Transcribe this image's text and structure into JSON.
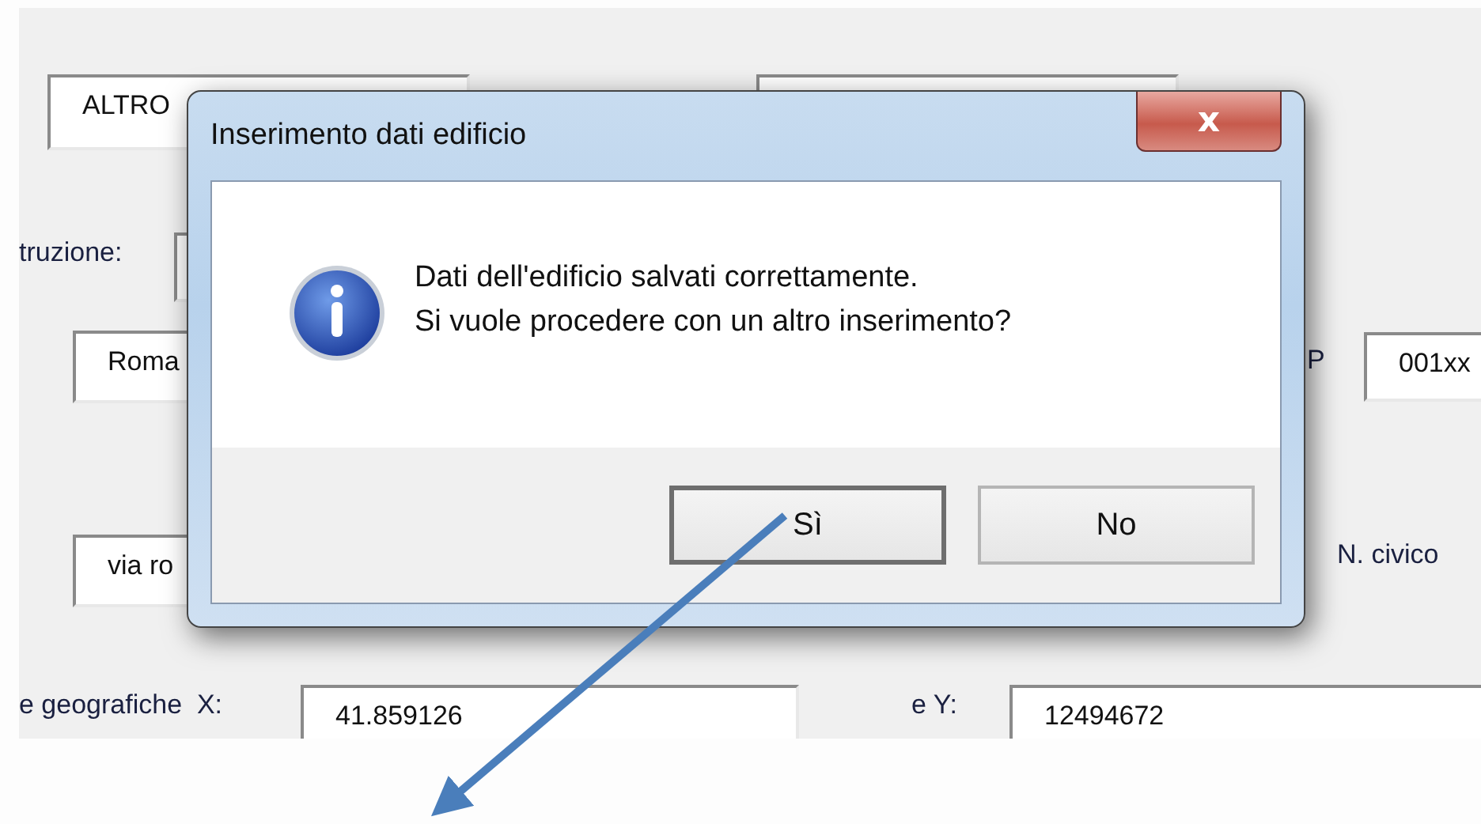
{
  "form": {
    "items": [
      {
        "kind": "field",
        "value": "ALTRO"
      },
      {
        "kind": "field",
        "value": ""
      },
      {
        "kind": "label",
        "text": "truzione:"
      },
      {
        "kind": "field",
        "value": ""
      },
      {
        "kind": "field",
        "value": "Roma"
      },
      {
        "kind": "label",
        "text": "P"
      },
      {
        "kind": "field",
        "value": "001xx"
      },
      {
        "kind": "field",
        "value": "via ro"
      },
      {
        "kind": "label",
        "text": "N. civico"
      },
      {
        "kind": "label",
        "text": "e geografiche  X:"
      },
      {
        "kind": "field",
        "value": "41.859126"
      },
      {
        "kind": "label",
        "text": "e Y:"
      },
      {
        "kind": "field",
        "value": "12494672"
      }
    ]
  },
  "dialog": {
    "title": "Inserimento dati edificio",
    "close": "x",
    "message": [
      "Dati dell'edificio salvati correttamente.",
      "Si vuole procedere con un altro inserimento?"
    ],
    "buttons": [
      {
        "label": "Sì",
        "selected": true
      },
      {
        "label": "No",
        "selected": false
      }
    ]
  }
}
